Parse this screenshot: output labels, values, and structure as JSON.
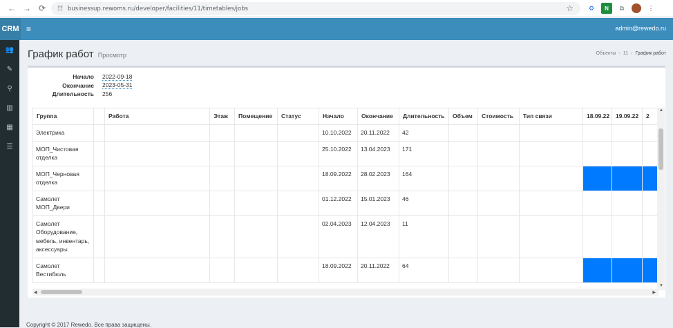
{
  "browser": {
    "url": "businessup.rewoms.ru/developer/facilities/11/timetables/jobs",
    "back_icon": "arrow-left-icon",
    "forward_icon": "arrow-right-icon",
    "reload_icon": "reload-icon"
  },
  "app": {
    "logo": "CRM",
    "user": "admin@rewedo.ru"
  },
  "page": {
    "title": "График работ",
    "subtitle": "Просмотр"
  },
  "breadcrumb": [
    "Объекты",
    "11",
    "График работ"
  ],
  "info": [
    {
      "label": "Начало",
      "value": "2022-09-18"
    },
    {
      "label": "Окончание",
      "value": "2023-05-31"
    },
    {
      "label": "Длительность",
      "value": "256"
    }
  ],
  "table": {
    "headers": [
      "Группа",
      "",
      "Работа",
      "Этаж",
      "Помещение",
      "Статус",
      "Начало",
      "Окончание",
      "Длительность",
      "Объем",
      "Стоимость",
      "Тип связи",
      "18.09.22",
      "19.09.22",
      "2"
    ],
    "rows": [
      {
        "group": "Электрика",
        "start": "10.10.2022",
        "end": "20.11.2022",
        "duration": "42",
        "bar": [
          false,
          false,
          false
        ]
      },
      {
        "group": "МОП_Чистовая отделка",
        "start": "25.10.2022",
        "end": "13.04.2023",
        "duration": "171",
        "bar": [
          false,
          false,
          false
        ]
      },
      {
        "group": "МОП_Черновая отделка",
        "start": "18.09.2022",
        "end": "28.02.2023",
        "duration": "164",
        "bar": [
          true,
          true,
          true
        ]
      },
      {
        "group": "Самолет МОП_Двери",
        "start": "01.12.2022",
        "end": "15.01.2023",
        "duration": "46",
        "bar": [
          false,
          false,
          false
        ]
      },
      {
        "group": "Самолет Оборудование, мебель, инвентарь, аксессуары",
        "start": "02.04.2023",
        "end": "12.04.2023",
        "duration": "11",
        "bar": [
          false,
          false,
          false
        ]
      },
      {
        "group": "Самолет Вестибюль",
        "start": "18.09.2022",
        "end": "20.11.2022",
        "duration": "64",
        "bar": [
          true,
          true,
          true
        ]
      }
    ]
  },
  "footer": "Copyright © 2017 Rewedo. Все права защищены."
}
